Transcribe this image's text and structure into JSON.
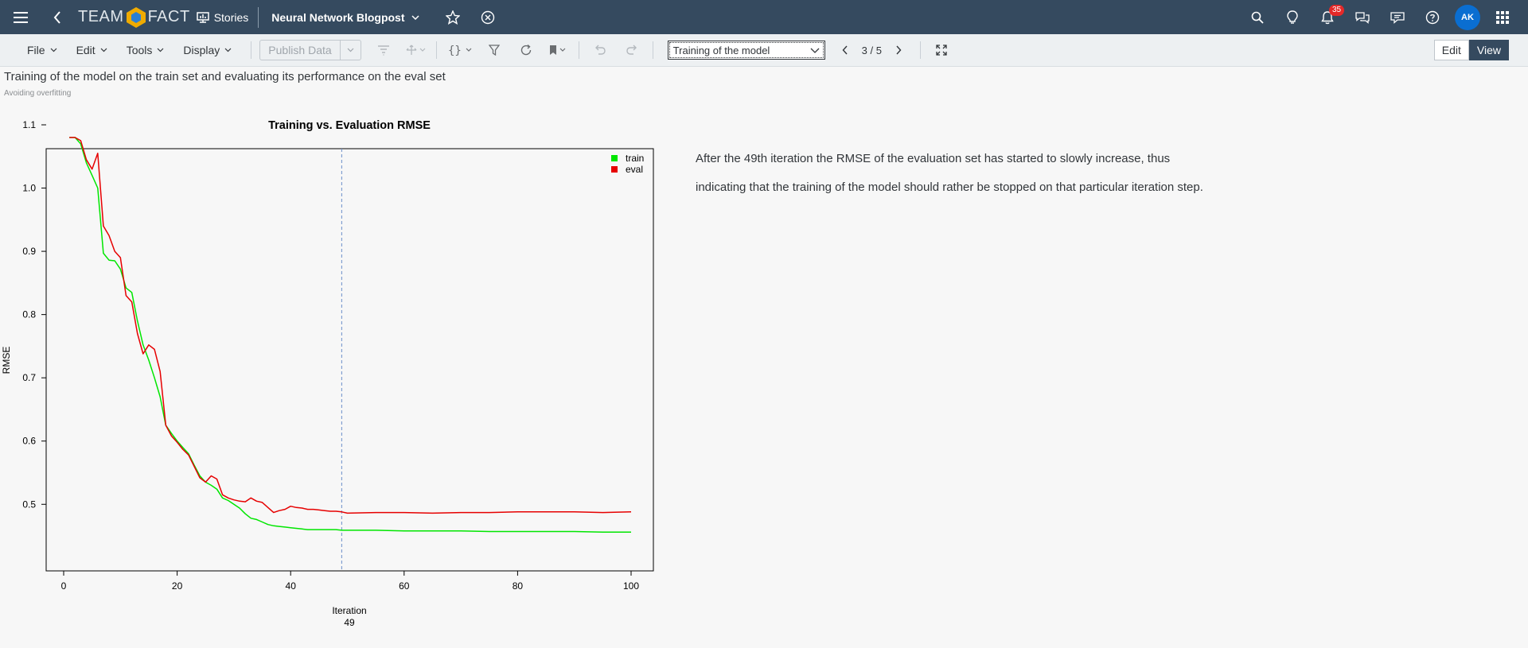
{
  "shellbar": {
    "logo_left": "TEAM",
    "logo_right": "FACT",
    "section": "Stories",
    "story_title": "Neural Network Blogpost",
    "notification_count": "35",
    "avatar_initials": "AK"
  },
  "toolbar": {
    "menus": [
      "File",
      "Edit",
      "Tools",
      "Display"
    ],
    "publish_label": "Publish Data",
    "page_select": "Training of the model",
    "pager": "3 / 5",
    "edit_label": "Edit",
    "view_label": "View"
  },
  "page": {
    "title": "Training of the model on the train set and evaluating its performance on the eval set",
    "subtitle": "Avoiding overfitting",
    "description": "After the 49th iteration the RMSE of the evaluation set has started to slowly increase, thus indicating that the training of the model should rather be stopped on that particular iteration step."
  },
  "chart_data": {
    "type": "line",
    "title": "Training vs. Evaluation RMSE",
    "xlabel": "Iteration",
    "ylabel": "RMSE",
    "xlim": [
      0,
      100
    ],
    "ylim": [
      0.44,
      1.1
    ],
    "xticks": [
      "0",
      "20",
      "40",
      "60",
      "80",
      "100"
    ],
    "yticks": [
      "0.5",
      "0.6",
      "0.7",
      "0.8",
      "0.9",
      "1.0",
      "1.1"
    ],
    "legend_position": "top-right",
    "vline": {
      "x": 49,
      "label": "49",
      "style": "dashed",
      "color": "#6b8fc9"
    },
    "x": [
      1,
      2,
      3,
      4,
      5,
      6,
      7,
      8,
      9,
      10,
      11,
      12,
      13,
      14,
      15,
      16,
      17,
      18,
      19,
      20,
      21,
      22,
      23,
      24,
      25,
      26,
      27,
      28,
      29,
      30,
      31,
      32,
      33,
      34,
      35,
      36,
      37,
      38,
      39,
      40,
      41,
      42,
      43,
      44,
      45,
      46,
      47,
      48,
      49,
      50,
      55,
      60,
      65,
      70,
      75,
      80,
      85,
      90,
      95,
      100
    ],
    "series": [
      {
        "name": "train",
        "color": "#00e600",
        "values": [
          1.08,
          1.08,
          1.07,
          1.04,
          1.02,
          1.0,
          0.897,
          0.886,
          0.885,
          0.872,
          0.842,
          0.835,
          0.79,
          0.752,
          0.728,
          0.7,
          0.67,
          0.625,
          0.612,
          0.6,
          0.59,
          0.58,
          0.562,
          0.545,
          0.535,
          0.53,
          0.524,
          0.51,
          0.506,
          0.5,
          0.494,
          0.485,
          0.478,
          0.476,
          0.472,
          0.468,
          0.466,
          0.465,
          0.464,
          0.463,
          0.462,
          0.461,
          0.46,
          0.46,
          0.46,
          0.46,
          0.46,
          0.46,
          0.459,
          0.459,
          0.459,
          0.458,
          0.458,
          0.458,
          0.457,
          0.457,
          0.457,
          0.457,
          0.456,
          0.456
        ]
      },
      {
        "name": "eval",
        "color": "#e60000",
        "values": [
          1.08,
          1.08,
          1.075,
          1.045,
          1.03,
          1.055,
          0.94,
          0.925,
          0.9,
          0.89,
          0.83,
          0.82,
          0.77,
          0.738,
          0.752,
          0.745,
          0.71,
          0.625,
          0.608,
          0.598,
          0.587,
          0.578,
          0.56,
          0.542,
          0.535,
          0.545,
          0.54,
          0.515,
          0.51,
          0.507,
          0.505,
          0.504,
          0.51,
          0.505,
          0.503,
          0.495,
          0.487,
          0.49,
          0.492,
          0.497,
          0.495,
          0.494,
          0.492,
          0.492,
          0.491,
          0.49,
          0.489,
          0.489,
          0.488,
          0.486,
          0.487,
          0.487,
          0.486,
          0.487,
          0.487,
          0.488,
          0.488,
          0.488,
          0.487,
          0.488
        ]
      }
    ]
  }
}
